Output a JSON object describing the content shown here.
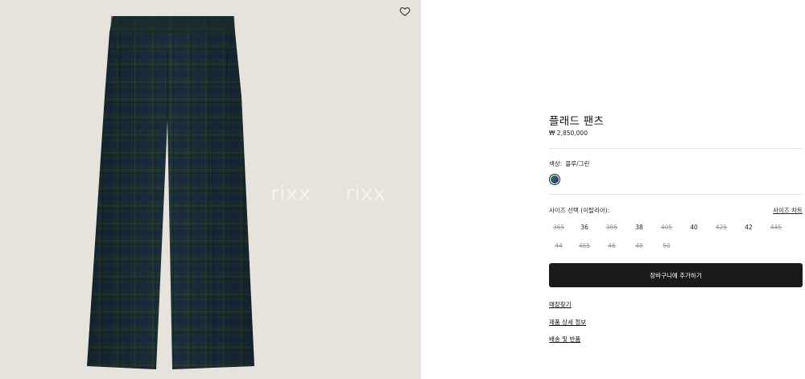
{
  "product": {
    "title": "플래드 팬츠",
    "price": "₩ 2,850,000"
  },
  "gallery": {
    "watermarks": [
      "rixx",
      "rixx"
    ],
    "wishlist_icon": "heart-icon"
  },
  "color": {
    "label": "색상:",
    "value": "블루/그린",
    "swatch_colors": [
      "#2e8a49",
      "#2a4d7a",
      "#1b2b45"
    ]
  },
  "size": {
    "label": "사이즈 선택 (이탈리아):",
    "chart_link": "사이즈 차트",
    "options": [
      {
        "label": "365",
        "available": false
      },
      {
        "label": "36",
        "available": true
      },
      {
        "label": "385",
        "available": false
      },
      {
        "label": "38",
        "available": true
      },
      {
        "label": "405",
        "available": false
      },
      {
        "label": "40",
        "available": true
      },
      {
        "label": "425",
        "available": false
      },
      {
        "label": "42",
        "available": true
      },
      {
        "label": "445",
        "available": false
      },
      {
        "label": "44",
        "available": false
      },
      {
        "label": "465",
        "available": false
      },
      {
        "label": "46",
        "available": false
      },
      {
        "label": "48",
        "available": false
      },
      {
        "label": "50",
        "available": false
      }
    ]
  },
  "actions": {
    "add_to_cart": "장바구니에 추가하기"
  },
  "links": {
    "store_finder": "매장찾기",
    "product_details": "제품 상세 정보",
    "shipping_returns": "배송 및 반품"
  },
  "colors": {
    "gallery_bg": "#e6e2dc",
    "button_bg": "#1a1a1a",
    "fabric": "#1d3532"
  }
}
